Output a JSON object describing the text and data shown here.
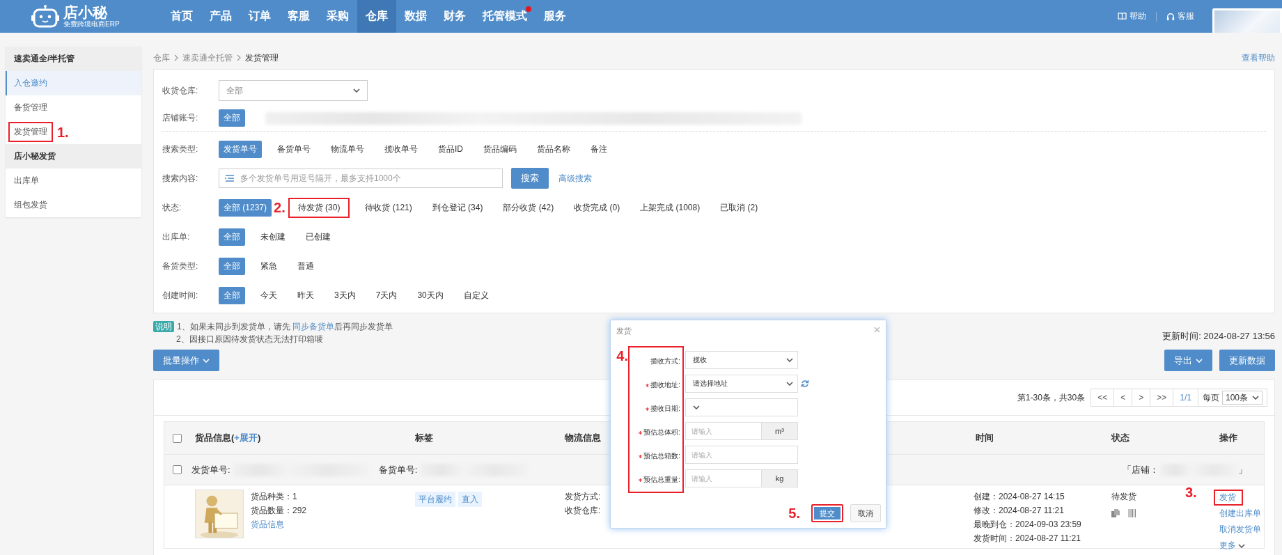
{
  "nav": {
    "logo_title": "店小秘",
    "logo_subtitle": "免费跨境电商ERP",
    "items": [
      {
        "label": "首页",
        "selected": false,
        "badge": false
      },
      {
        "label": "产品",
        "selected": false,
        "badge": false
      },
      {
        "label": "订单",
        "selected": false,
        "badge": false
      },
      {
        "label": "客服",
        "selected": false,
        "badge": false
      },
      {
        "label": "采购",
        "selected": false,
        "badge": false
      },
      {
        "label": "仓库",
        "selected": true,
        "badge": false
      },
      {
        "label": "数据",
        "selected": false,
        "badge": false
      },
      {
        "label": "财务",
        "selected": false,
        "badge": false
      },
      {
        "label": "托管模式",
        "selected": false,
        "badge": true
      },
      {
        "label": "服务",
        "selected": false,
        "badge": false
      }
    ],
    "help": "帮助",
    "service": "客服"
  },
  "sidebar": [
    {
      "title": "速卖通全/半托管",
      "items": [
        {
          "label": "入仓邀约",
          "selected": true,
          "highlighted": false
        },
        {
          "label": "备货管理",
          "selected": false,
          "highlighted": false
        },
        {
          "label": "发货管理",
          "selected": false,
          "highlighted": true,
          "annotation": "1."
        }
      ]
    },
    {
      "title": "店小秘发货",
      "items": [
        {
          "label": "出库单",
          "selected": false,
          "highlighted": false
        },
        {
          "label": "组包发货",
          "selected": false,
          "highlighted": false
        }
      ]
    }
  ],
  "breadcrumb": [
    "仓库",
    "速卖通全托管",
    "发货管理"
  ],
  "help_link": "查看帮助",
  "filters": [
    {
      "kind": "select",
      "label": "收货仓库:",
      "value": "全部"
    },
    {
      "kind": "options",
      "label": "店铺账号:",
      "blurred": true,
      "divider_after": true,
      "options": [
        {
          "label": "全部",
          "selected": true,
          "highlighted": false
        }
      ]
    },
    {
      "kind": "options",
      "label": "搜索类型:",
      "options": [
        {
          "label": "发货单号",
          "selected": true,
          "highlighted": false
        },
        {
          "label": "备货单号",
          "selected": false,
          "highlighted": false
        },
        {
          "label": "物流单号",
          "selected": false,
          "highlighted": false
        },
        {
          "label": "揽收单号",
          "selected": false,
          "highlighted": false
        },
        {
          "label": "货品ID",
          "selected": false,
          "highlighted": false
        },
        {
          "label": "货品编码",
          "selected": false,
          "highlighted": false
        },
        {
          "label": "货品名称",
          "selected": false,
          "highlighted": false
        },
        {
          "label": "备注",
          "selected": false,
          "highlighted": false
        }
      ]
    },
    {
      "kind": "search",
      "label": "搜索内容:",
      "placeholder": "多个发货单号用逗号隔开，最多支持1000个",
      "button": "搜索",
      "link": "高级搜索"
    },
    {
      "kind": "options",
      "label": "状态:",
      "options": [
        {
          "label": "全部 (1237)",
          "selected": true,
          "highlighted": false
        },
        {
          "label": "待发货 (30)",
          "selected": false,
          "highlighted": true,
          "annotation": "2."
        },
        {
          "label": "待收货 (121)",
          "selected": false,
          "highlighted": false
        },
        {
          "label": "到仓登记 (34)",
          "selected": false,
          "highlighted": false
        },
        {
          "label": "部分收货 (42)",
          "selected": false,
          "highlighted": false
        },
        {
          "label": "收货完成 (0)",
          "selected": false,
          "highlighted": false
        },
        {
          "label": "上架完成 (1008)",
          "selected": false,
          "highlighted": false
        },
        {
          "label": "已取消 (2)",
          "selected": false,
          "highlighted": false
        }
      ]
    },
    {
      "kind": "options",
      "label": "出库单:",
      "options": [
        {
          "label": "全部",
          "selected": true,
          "highlighted": false
        },
        {
          "label": "未创建",
          "selected": false,
          "highlighted": false
        },
        {
          "label": "已创建",
          "selected": false,
          "highlighted": false
        }
      ]
    },
    {
      "kind": "options",
      "label": "备货类型:",
      "options": [
        {
          "label": "全部",
          "selected": true,
          "highlighted": false
        },
        {
          "label": "紧急",
          "selected": false,
          "highlighted": false
        },
        {
          "label": "普通",
          "selected": false,
          "highlighted": false
        }
      ]
    },
    {
      "kind": "options",
      "label": "创建时间:",
      "options": [
        {
          "label": "全部",
          "selected": true,
          "highlighted": false
        },
        {
          "label": "今天",
          "selected": false,
          "highlighted": false
        },
        {
          "label": "昨天",
          "selected": false,
          "highlighted": false
        },
        {
          "label": "3天内",
          "selected": false,
          "highlighted": false
        },
        {
          "label": "7天内",
          "selected": false,
          "highlighted": false
        },
        {
          "label": "30天内",
          "selected": false,
          "highlighted": false
        },
        {
          "label": "自定义",
          "selected": false,
          "highlighted": false
        }
      ]
    }
  ],
  "notes": {
    "badge": "说明",
    "line1_before": "1、如果未同步到发货单，请先 ",
    "line1_link": "同步备货单",
    "line1_after": "后再同步发货单",
    "line2": "2、因接口原因待发货状态无法打印箱唛"
  },
  "update_time": "更新时间: 2024-08-27 13:56",
  "batch_button": "批量操作",
  "export_button": "导出",
  "refresh_button": "更新数据",
  "pagination": {
    "summary": "第1-30条，共30条",
    "buttons": [
      "<<",
      "<",
      ">",
      ">>"
    ],
    "page": "1/1",
    "per_page_label": "每页",
    "per_page": "100条"
  },
  "table": {
    "header_checked": false,
    "columns": [
      {
        "label": "货品信息(",
        "link": "+展开",
        "suffix": ")"
      },
      {
        "label": "标签"
      },
      {
        "label": "物流信息"
      },
      {
        "label": "时间"
      },
      {
        "label": "状态"
      },
      {
        "label": "操作"
      }
    ],
    "group": {
      "checked": false,
      "shipment_label": "发货单号:",
      "stock_label": "备货单号:",
      "shop_open": "「店铺：",
      "shop_close": "」"
    },
    "row": {
      "goods_kinds": "货品种类：1",
      "goods_qty": "货品数量：292",
      "goods_link": "货品信息",
      "tags": [
        "平台履约",
        "直入"
      ],
      "logistics": [
        "发货方式:",
        "收货仓库:"
      ],
      "times": [
        "创建：2024-08-27 14:15",
        "修改：2024-08-27 11:21",
        "最晚到仓：2024-09-03 23:59",
        "发货时间：2024-08-27 11:21"
      ],
      "status": "待发货",
      "actions": [
        {
          "label": "发货",
          "highlighted": true,
          "annotation": "3."
        },
        {
          "label": "创建出库单",
          "highlighted": false
        },
        {
          "label": "取消发货单",
          "highlighted": false
        },
        {
          "label": "更多",
          "highlighted": false,
          "menu": true
        }
      ]
    }
  },
  "dialog": {
    "title": "发货",
    "labels_highlighted": true,
    "annotation": "4.",
    "fields": [
      {
        "label": "揽收方式:",
        "required": false,
        "kind": "select",
        "value": "揽收"
      },
      {
        "label": "揽收地址:",
        "required": true,
        "kind": "select",
        "value": "请选择地址",
        "refresh": true
      },
      {
        "label": "揽收日期:",
        "required": true,
        "kind": "select"
      },
      {
        "label": "预估总体积:",
        "required": true,
        "kind": "unit",
        "placeholder": "请输入",
        "unit": "m³"
      },
      {
        "label": "预估总箱数:",
        "required": true,
        "kind": "input",
        "placeholder": "请输入"
      },
      {
        "label": "预估总重量:",
        "required": true,
        "kind": "unit",
        "placeholder": "请输入",
        "unit": "kg"
      }
    ],
    "buttons": [
      {
        "label": "提交",
        "kind": "primary",
        "highlighted": true,
        "annotation": "5."
      },
      {
        "label": "取消",
        "kind": "default",
        "highlighted": false
      }
    ]
  }
}
